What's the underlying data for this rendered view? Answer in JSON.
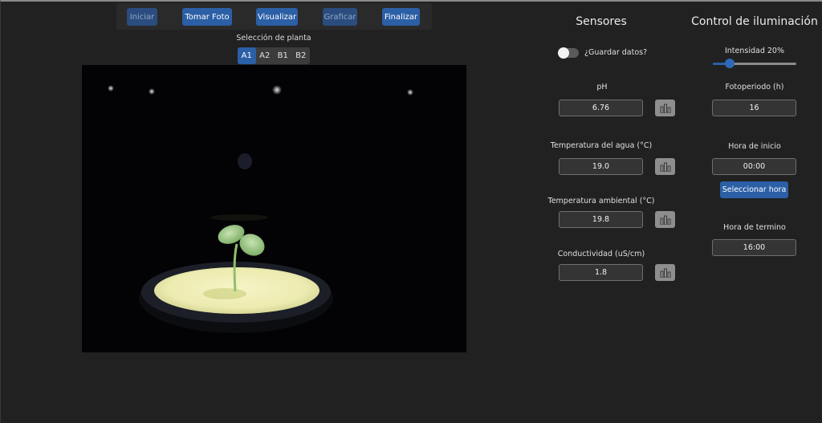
{
  "toolbar": {
    "buttons": [
      {
        "label": "Iniciar",
        "enabled": false
      },
      {
        "label": "Tomar Foto",
        "enabled": true
      },
      {
        "label": "Visualizar",
        "enabled": true
      },
      {
        "label": "Graficar",
        "enabled": false
      },
      {
        "label": "Finalizar",
        "enabled": true
      }
    ]
  },
  "plant_selection": {
    "label": "Selección de planta",
    "options": [
      "A1",
      "A2",
      "B1",
      "B2"
    ],
    "selected": "A1"
  },
  "sensors": {
    "title": "Sensores",
    "save_label": "¿Guardar datos?",
    "save_enabled": false,
    "items": [
      {
        "label": "pH",
        "value": "6.76",
        "icon": "bar-chart-icon"
      },
      {
        "label": "Temperatura del agua (°C)",
        "value": "19.0",
        "icon": "bar-chart-icon"
      },
      {
        "label": "Temperatura ambiental (°C)",
        "value": "19.8",
        "icon": "bar-chart-icon"
      },
      {
        "label": "Conductividad (uS/cm)",
        "value": "1.8",
        "icon": "bar-chart-icon"
      }
    ]
  },
  "lighting": {
    "title": "Control de iluminación",
    "intensity_label": "Intensidad 20%",
    "intensity_fraction": 0.2,
    "photoperiod_label": "Fotoperiodo (h)",
    "photoperiod_value": "16",
    "start_label": "Hora de inicio",
    "start_value": "00:00",
    "select_button": "Seleccionar hora",
    "end_label": "Hora de termino",
    "end_value": "16:00"
  },
  "colors": {
    "accent": "#2b5fa6",
    "background": "#212121",
    "field": "#343434"
  }
}
